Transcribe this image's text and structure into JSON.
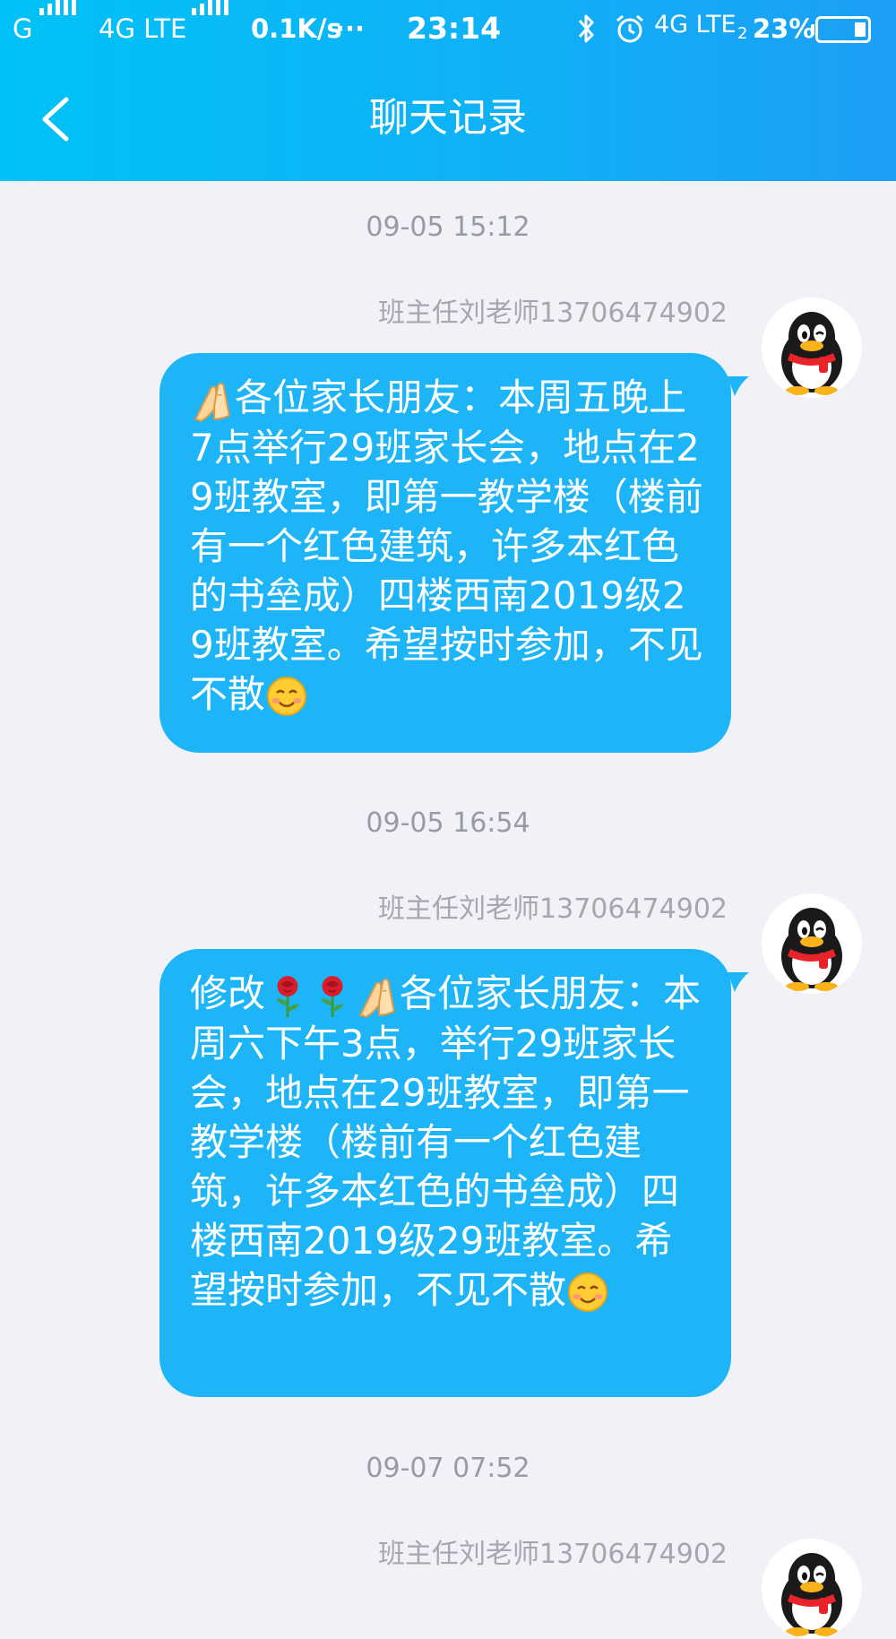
{
  "status_bar": {
    "carrier_1": "G",
    "carrier_2": "4G LTE",
    "net_speed": "0.1K/s",
    "more": "···",
    "time": "23:14",
    "network_right": "4G LTE",
    "network_right_sub": "2",
    "battery_text": "23%",
    "battery_level": 0.23
  },
  "header": {
    "title": "聊天记录"
  },
  "colors": {
    "header": "#0fb1f6",
    "bubble": "#1db5f7",
    "background": "#f1f2f7"
  },
  "messages": [
    {
      "timestamp": "09-05 15:12",
      "sender": "班主任刘老师13706474902",
      "text": "各位家长朋友：本周五晚上7点举行29班家长会，地点在29班教室，即第一教学楼（楼前有一个红色建筑，许多本红色的书垒成）四楼西南2019级29班教室。希望按时参加，不见不散",
      "leading_emoji": [
        "folded-hands"
      ],
      "trailing_emoji": "smiling-face"
    },
    {
      "timestamp": "09-05 16:54",
      "sender": "班主任刘老师13706474902",
      "prefix": "修改",
      "text": "各位家长朋友：本周六下午3点，举行29班家长会，地点在29班教室，即第一教学楼（楼前有一个红色建筑，许多本红色的书垒成）四楼西南2019级29班教室。希望按时参加，不见不散",
      "leading_emoji": [
        "rose",
        "rose",
        "folded-hands"
      ],
      "trailing_emoji": "smiling-face"
    },
    {
      "timestamp": "09-07 07:52",
      "sender": "班主任刘老师13706474902"
    }
  ]
}
